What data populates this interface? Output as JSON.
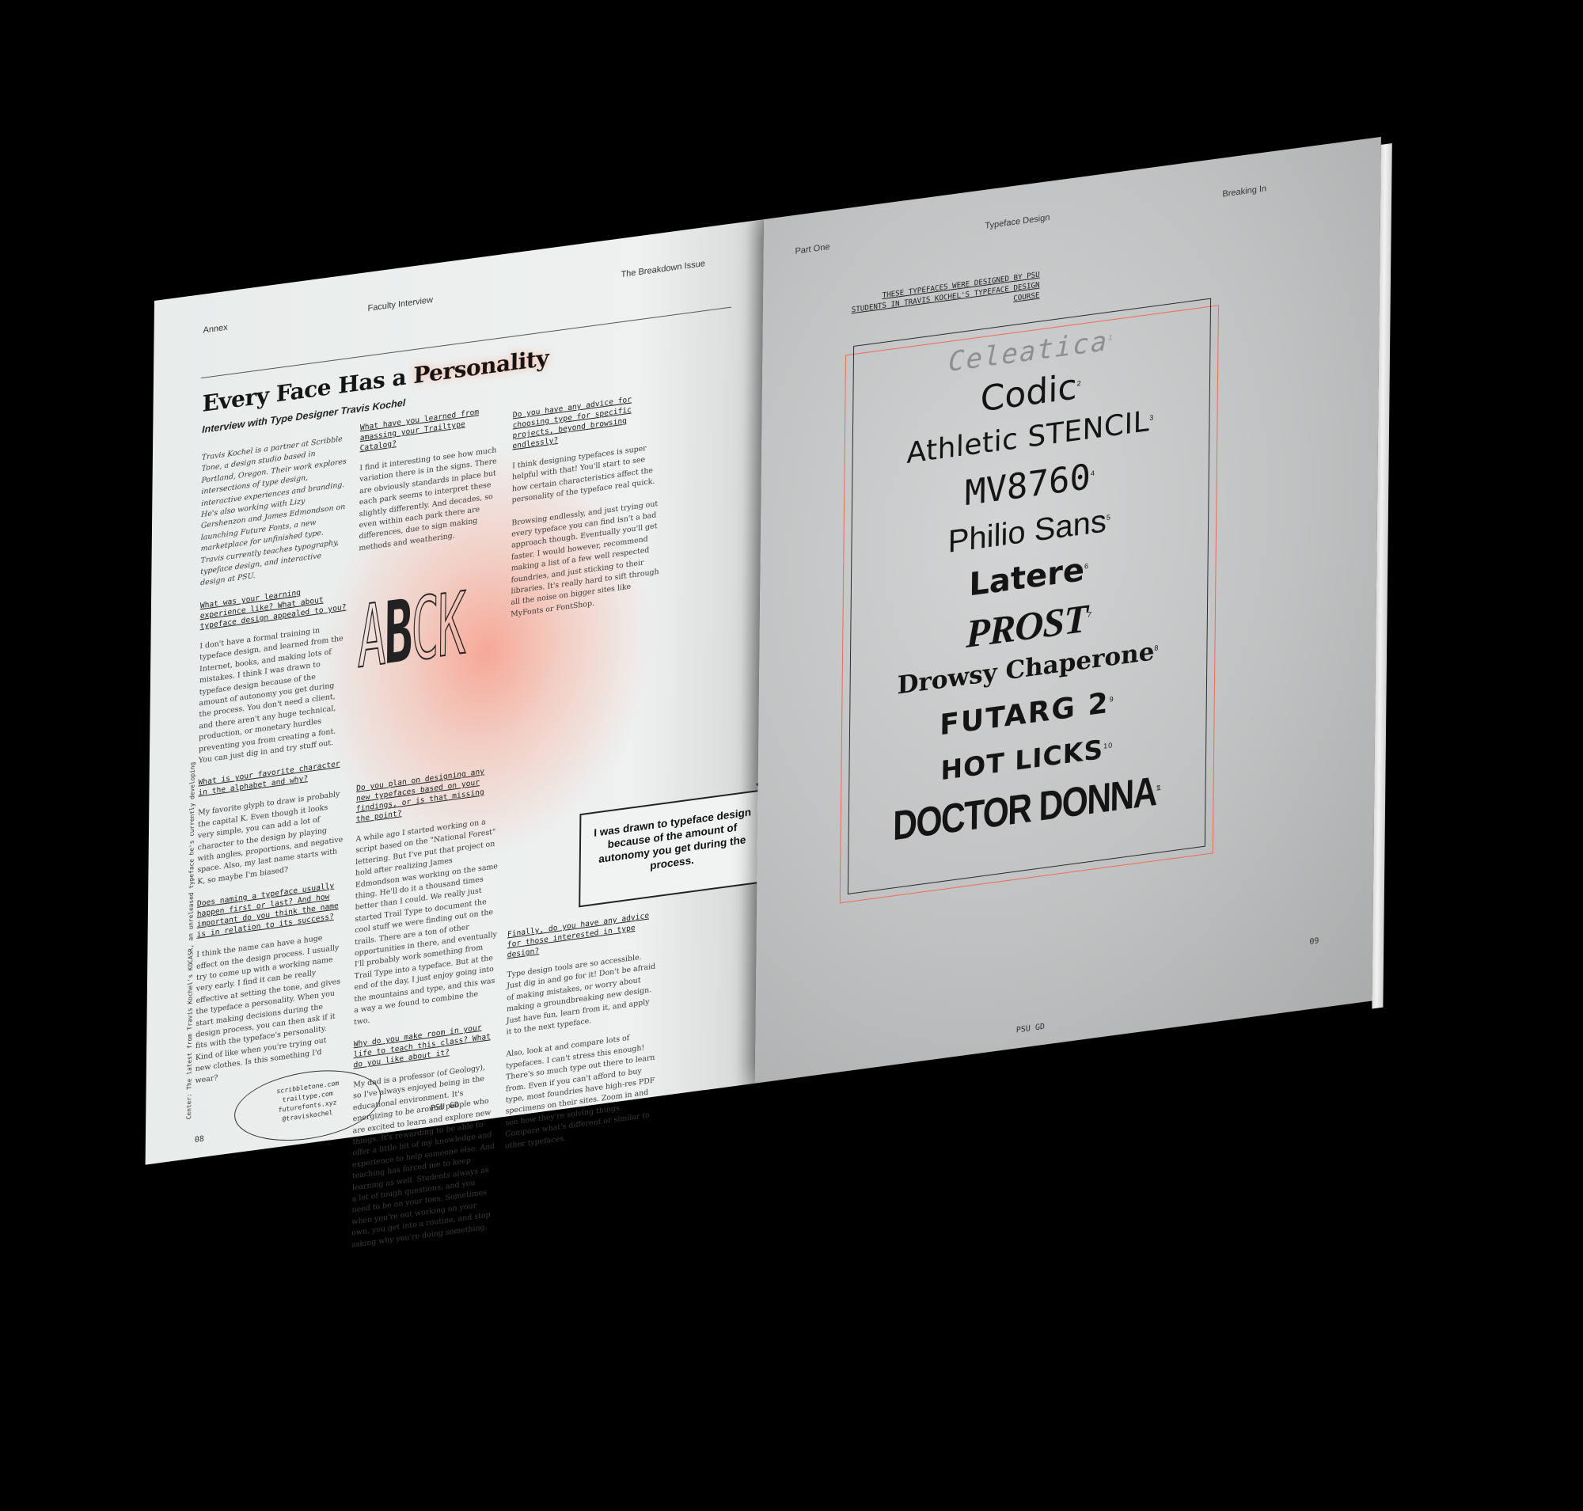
{
  "left_page": {
    "running_heads": {
      "section": "Annex",
      "category": "Faculty Interview",
      "issue": "The Breakdown Issue"
    },
    "title_pre": "Every Face Has a ",
    "title_highlight": "Personality",
    "subtitle": "Interview with Type Designer Travis Kochel",
    "intro": "Travis Kochel is a partner at Scribble Tone, a design studio based in Portland, Oregon. Their work explores intersections of type design, interactive experiences and branding. He's also working with Lizy Gershenzon and James Edmondson on launching Future Fonts, a new marketplace for unfinished type. Travis currently teaches typography, typeface design, and interactive design at PSU.",
    "q1": "What was your learning experience like? What about typeface design appealed to you?",
    "a1": "I don't have a formal training in typeface design, and learned from the Internet, books, and making lots of mistakes. I think I was drawn to typeface design because of the amount of autonomy you get during the process. You don't need a client, and there aren't any huge technical, production, or monetary hurdles preventing you from creating a font. You can just dig in and try stuff out.",
    "q2": "What is your favorite character in the alphabet and why?",
    "a2": "My favorite glyph to draw is probably the capital K. Even though it looks very simple, you can add a lot of character to the design by playing with angles, proportions, and negative space. Also, my last name starts with K, so maybe I'm biased?",
    "q3": "Does naming a typeface usually happen first or last? And how important do you think the name is in relation to its success?",
    "a3": "I think the name can have a huge effect on the design process. I usually try to come up with a working name very early. I find it can be really effective at setting the tone, and gives the typeface a personality. When you start making decisions during the design process, you can then ask if it fits with the typeface's personality. Kind of like when you're trying out new clothes. Is this something I'd wear?",
    "q4": "What have you learned from amassing your Trailtype Catalog?",
    "a4": "I find it interesting to see how much variation there is in the signs. There are obviously standards in place but each park seems to interpret these slightly differently. And decades, so even within each park there are differences, due to sign making methods and weathering.",
    "abck": {
      "l1": "A",
      "l2": "B",
      "l3": "C",
      "l4": "K"
    },
    "q5": "Do you plan on designing any new typefaces based on your findings, or is that missing the point?",
    "a5": "A while ago I started working on a script based on the \"National Forest\" lettering. But I've put that project on hold after realizing James Edmondson was working on the same thing. He'll do it a thousand times better than I could. We really just started Trail Type to document the cool stuff we were finding out on the trails. There are a ton of other opportunities in there, and eventually I'll probably work something from Trail Type into a typeface. But at the end of the day, I just enjoy going into the mountains and type, and this was a way a we found to combine the two.",
    "q6": "Why do you make room in your life to teach this class? What do you like about it?",
    "a6": "My dad is a professor (of Geology), so I've always enjoyed being in the educational environment. It's energizing to be around people who are excited to learn and explore new things. It's rewarding to be able to offer a little bit of my knowledge and experience to help someone else. And teaching has forced me to keep learning as well. Students always as a lot of tough questions, and you need to be on your toes. Sometimes when you're out working on your own, you get into a routine, and stop asking why you're doing something.",
    "q7": "Do you have any advice for choosing type for specific projects, beyond browsing endlessly?",
    "a7": "I think designing typefaces is super helpful with that! You'll start to see how certain characteristics affect the personality of the typeface real quick.",
    "a7b": "Browsing endlessly, and just trying out every typeface you can find isn't a bad approach though. Eventually you'll get faster. I would however, recommend making a list of a few well respected foundries, and just sticking to their libraries. It's really hard to sift through all the noise on bigger sites like MyFonts or FontShop.",
    "pull_quote": "I was drawn to typeface design because of the amount of autonomy you get during the process.",
    "pull_quote_mark": "”",
    "q8": "Finally, do you have any advice for those interested in type design?",
    "a8": "Type design tools are so accessible. Just dig in and go for it! Don't be afraid of making mistakes, or worry about making a groundbreaking new design. Just have fun, learn from it, and apply it to the next typeface.",
    "a8b": "Also, look at and compare lots of typefaces. I can't stress this enough! There's so much type out there to learn from. Even if you can't afford to buy type, most foundries have high-res PDF specimens on their sites. Zoom in and see how they're solving things. Compare what's different or similar to other typefaces.",
    "links": [
      "scribbletone.com",
      "trailtype.com",
      "futurefonts.xyz",
      "@traviskochel"
    ],
    "vertical_caption": "Center: The latest from Travis Kochel's KOCASR, an unreleased typeface he's currently developing",
    "footer": "PSU GD",
    "page_number": "08"
  },
  "right_page": {
    "running_heads": {
      "part": "Part One",
      "category": "Typeface Design",
      "section": "Breaking In"
    },
    "caption": "THESE TYPEFACES WERE DESIGNED BY PSU STUDENTS IN TRAVIS KOCHEL'S TYPEFACE DESIGN COURSE",
    "specimens": [
      {
        "name": "Celeatica",
        "num": "1"
      },
      {
        "name": "Codic",
        "num": "2"
      },
      {
        "name": "Athletic STENCIL",
        "num": "3"
      },
      {
        "name": "MV8760",
        "num": "4"
      },
      {
        "name": "Philio Sans",
        "num": "5"
      },
      {
        "name": "Latere",
        "num": "6"
      },
      {
        "name": "PROST",
        "num": "7"
      },
      {
        "name": "Drowsy Chaperone",
        "num": "8"
      },
      {
        "name": "FUTARG 2",
        "num": "9"
      },
      {
        "name": "HOT LICKS",
        "num": "10"
      },
      {
        "name": "DOCTOR DONNA",
        "num": "11"
      }
    ],
    "footer": "PSU GD",
    "page_number": "09"
  },
  "colors": {
    "accent": "#ef6a55",
    "background": "#000000",
    "paper": "#eceff0"
  }
}
